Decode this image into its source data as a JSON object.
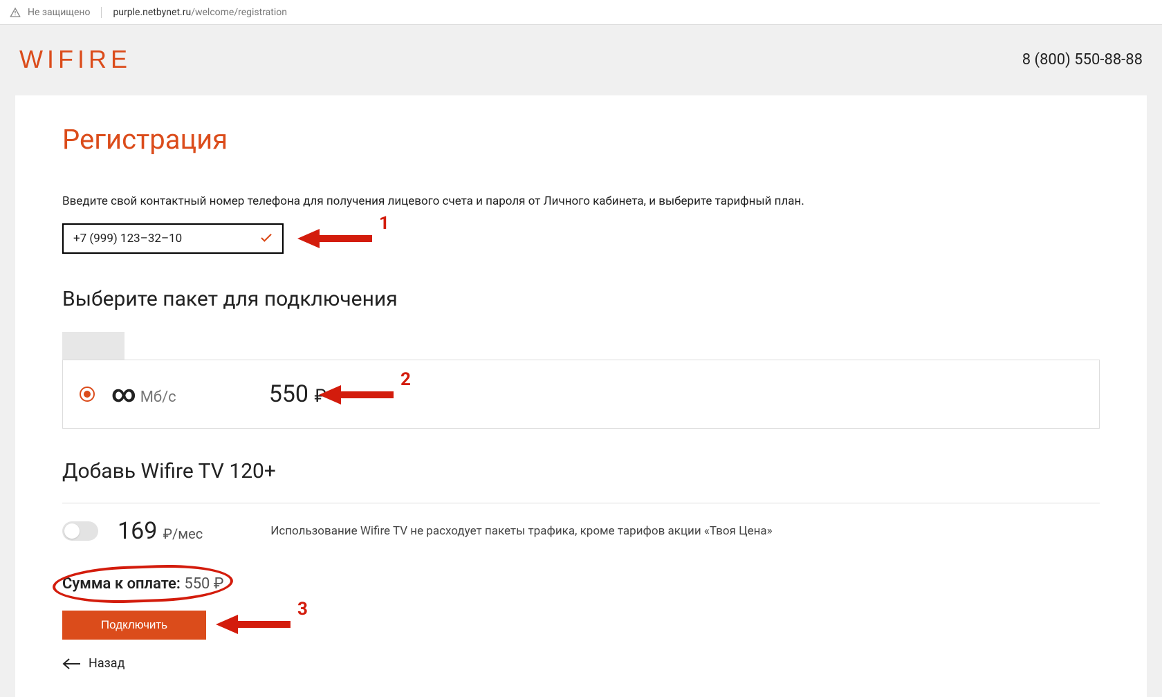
{
  "browser": {
    "security_label": "Не защищено",
    "url_host": "purple.netbynet.ru",
    "url_path": "/welcome/registration"
  },
  "header": {
    "logo_text": "WIFIRE",
    "phone": "8 (800) 550-88-88"
  },
  "page": {
    "title": "Регистрация",
    "instruction": "Введите свой контактный номер телефона для получения лицевого счета и пароля от Личного кабинета, и выберите тарифный план."
  },
  "phone_input": {
    "value": "+7 (999) 123–32–10"
  },
  "plan": {
    "section_title": "Выберите пакет для подключения",
    "speed_symbol": "∞",
    "speed_unit": "Мб/с",
    "price": "550",
    "currency": "₽"
  },
  "tv": {
    "title": "Добавь Wifire TV 120+",
    "price": "169",
    "currency": "₽",
    "per": "/мес",
    "description": "Использование Wifire TV не расходует пакеты трафика, кроме тарифов акции «Твоя Цена»"
  },
  "total": {
    "label": "Сумма к оплате:",
    "value": "550 ₽"
  },
  "buttons": {
    "connect": "Подключить",
    "back": "Назад"
  },
  "annotations": {
    "one": "1",
    "two": "2",
    "three": "3"
  }
}
